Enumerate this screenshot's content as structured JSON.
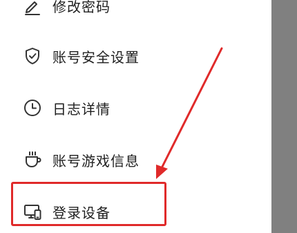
{
  "menu": {
    "items": [
      {
        "label": "修改密码",
        "icon": "pencil-icon"
      },
      {
        "label": "账号安全设置",
        "icon": "shield-check-icon"
      },
      {
        "label": "日志详情",
        "icon": "clock-icon"
      },
      {
        "label": "账号游戏信息",
        "icon": "cup-icon"
      },
      {
        "label": "登录设备",
        "icon": "devices-icon"
      }
    ]
  },
  "annotation": {
    "color": "#e02a2a"
  },
  "colors": {
    "overlay": "#808080",
    "text": "#1f1f1f"
  }
}
